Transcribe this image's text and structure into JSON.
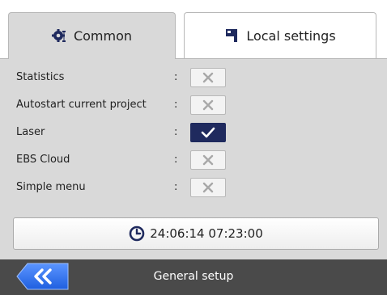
{
  "tabs": [
    {
      "label": "Common",
      "icon": "gears-icon",
      "active": true
    },
    {
      "label": "Local settings",
      "icon": "flag-icon",
      "active": false
    }
  ],
  "settings": [
    {
      "label": "Statistics",
      "colon": ":",
      "checked": false
    },
    {
      "label": "Autostart current project",
      "colon": ":",
      "checked": false
    },
    {
      "label": "Laser",
      "colon": ":",
      "checked": true
    },
    {
      "label": "EBS Cloud",
      "colon": ":",
      "checked": false
    },
    {
      "label": "Simple menu",
      "colon": ":",
      "checked": false
    }
  ],
  "datetime": {
    "value": "24:06:14 07:23:00",
    "icon": "clock-icon"
  },
  "footer": {
    "title": "General setup",
    "back_icon": "double-chevron-left-icon"
  },
  "colors": {
    "accent": "#1f2a5e",
    "back_button": "#2f6ff0",
    "panel_bg": "#d9d9d9",
    "footer_bg": "#4a4a4a"
  }
}
